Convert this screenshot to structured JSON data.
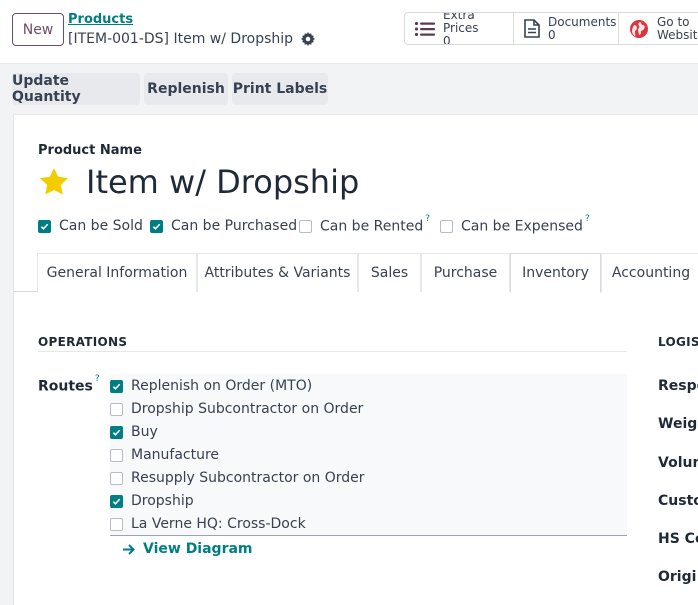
{
  "header": {
    "new_label": "New",
    "breadcrumb_parent": "Products",
    "breadcrumb_current": "[ITEM-001-DS] Item w/ Dropship"
  },
  "smart_buttons": [
    {
      "icon": "list-icon",
      "title": "Extra Prices",
      "value": "0"
    },
    {
      "icon": "document-icon",
      "title": "Documents",
      "value": "0"
    },
    {
      "icon": "globe-icon",
      "title": "Go to",
      "value": "Website"
    }
  ],
  "actions": {
    "update_quantity": "Update Quantity",
    "replenish": "Replenish",
    "print_labels": "Print Labels"
  },
  "product": {
    "name_label": "Product Name",
    "name": "Item w/ Dropship",
    "flags": [
      {
        "label": "Can be Sold",
        "checked": true,
        "help": ""
      },
      {
        "label": "Can be Purchased",
        "checked": true,
        "help": ""
      },
      {
        "label": "Can be Rented",
        "checked": false,
        "help": "?"
      },
      {
        "label": "Can be Expensed",
        "checked": false,
        "help": "?"
      }
    ]
  },
  "tabs": [
    "General Information",
    "Attributes & Variants",
    "Sales",
    "Purchase",
    "Inventory",
    "Accounting"
  ],
  "active_tab": "Inventory",
  "operations": {
    "title": "OPERATIONS",
    "routes_label": "Routes",
    "routes_help": "?",
    "routes": [
      {
        "label": "Replenish on Order (MTO)",
        "checked": true
      },
      {
        "label": "Dropship Subcontractor on Order",
        "checked": false
      },
      {
        "label": "Buy",
        "checked": true
      },
      {
        "label": "Manufacture",
        "checked": false
      },
      {
        "label": "Resupply Subcontractor on Order",
        "checked": false
      },
      {
        "label": "Dropship",
        "checked": true
      },
      {
        "label": "La Verne HQ: Cross-Dock",
        "checked": false
      }
    ],
    "view_diagram": "View Diagram"
  },
  "logistics": {
    "title": "LOGIST",
    "fields": [
      "Respo",
      "Weigh",
      "Volum",
      "Custo",
      "HS Co",
      "Origi"
    ]
  },
  "colors": {
    "accent": "#017e84",
    "brand": "#714b67",
    "star": "#f3cc00"
  }
}
